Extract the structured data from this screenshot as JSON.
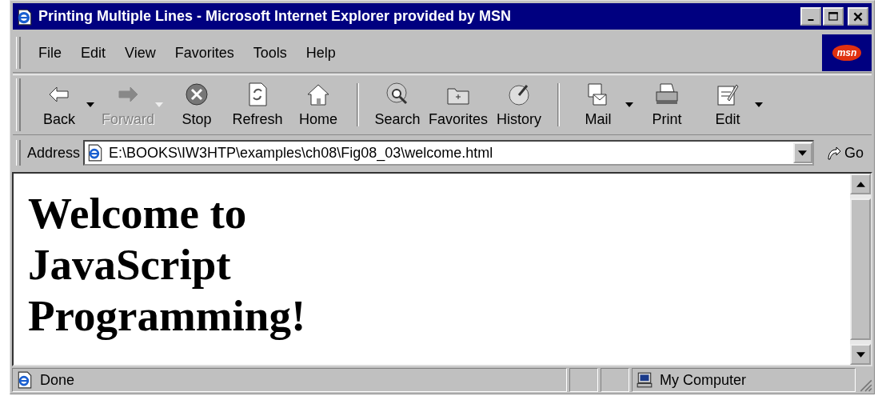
{
  "window": {
    "title": "Printing Multiple Lines - Microsoft Internet Explorer provided by MSN"
  },
  "menu": [
    "File",
    "Edit",
    "View",
    "Favorites",
    "Tools",
    "Help"
  ],
  "logo": "msn",
  "toolbar": [
    {
      "kind": "back",
      "label": "Back",
      "disabled": false,
      "dropdown": true
    },
    {
      "kind": "forward",
      "label": "Forward",
      "disabled": true,
      "dropdown": true
    },
    {
      "kind": "stop",
      "label": "Stop",
      "disabled": false,
      "dropdown": false
    },
    {
      "kind": "refresh",
      "label": "Refresh",
      "disabled": false,
      "dropdown": false
    },
    {
      "kind": "home",
      "label": "Home",
      "disabled": false,
      "dropdown": false
    },
    {
      "kind": "separator"
    },
    {
      "kind": "search",
      "label": "Search",
      "disabled": false,
      "dropdown": false
    },
    {
      "kind": "favorites",
      "label": "Favorites",
      "disabled": false,
      "dropdown": false
    },
    {
      "kind": "history",
      "label": "History",
      "disabled": false,
      "dropdown": false
    },
    {
      "kind": "separator"
    },
    {
      "kind": "mail",
      "label": "Mail",
      "disabled": false,
      "dropdown": true
    },
    {
      "kind": "print",
      "label": "Print",
      "disabled": false,
      "dropdown": false
    },
    {
      "kind": "edit",
      "label": "Edit",
      "disabled": false,
      "dropdown": true
    }
  ],
  "address": {
    "label": "Address",
    "value": "E:\\BOOKS\\IW3HTP\\examples\\ch08\\Fig08_03\\welcome.html",
    "go": "Go"
  },
  "page": {
    "heading_lines": [
      "Welcome to",
      "JavaScript",
      "Programming!"
    ]
  },
  "status_bar": {
    "text": "Done",
    "zone": "My Computer"
  }
}
